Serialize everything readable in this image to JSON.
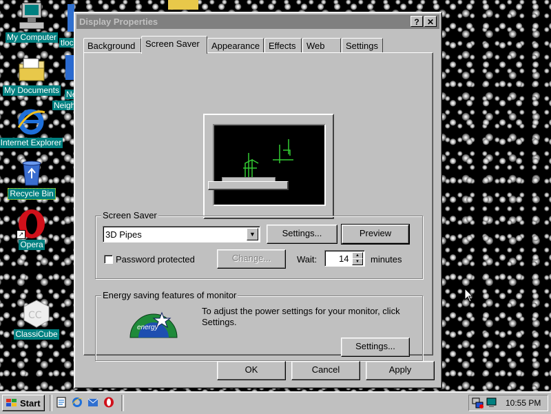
{
  "desktop": {
    "icons": [
      {
        "label": "My Computer"
      },
      {
        "label": "My Documents"
      },
      {
        "label": "Internet Explorer"
      },
      {
        "label": "Recycle Bin"
      },
      {
        "label": "Opera"
      },
      {
        "label": "ClassiCube"
      }
    ],
    "partial_labels": {
      "tloc": "tloc",
      "ne": "Ne",
      "neigh": "Neigh"
    },
    "cursor_icon": "mouse-pointer-icon"
  },
  "window": {
    "title": "Display Properties",
    "help_label": "?",
    "close_label": "✕",
    "tabs": [
      {
        "label": "Background"
      },
      {
        "label": "Screen Saver",
        "active": true
      },
      {
        "label": "Appearance"
      },
      {
        "label": "Effects"
      },
      {
        "label": "Web"
      },
      {
        "label": "Settings"
      }
    ],
    "screen_saver": {
      "group_label": "Screen Saver",
      "selected": "3D Pipes",
      "settings_button": "Settings...",
      "preview_button": "Preview",
      "password_label": "Password protected",
      "password_checked": false,
      "change_button": "Change...",
      "wait_label": "Wait:",
      "wait_value": "14",
      "minutes_label": "minutes"
    },
    "energy": {
      "group_label": "Energy saving features of monitor",
      "description": "To adjust the power settings for your monitor, click Settings.",
      "settings_button": "Settings...",
      "logo_text": "energy"
    },
    "buttons": {
      "ok": "OK",
      "cancel": "Cancel",
      "apply": "Apply"
    },
    "colors": {
      "pipe_green": "#33cc33",
      "screen": "#000000",
      "dialog": "#c0c0c0",
      "desktop_label_bg": "#008080"
    }
  },
  "taskbar": {
    "start_label": "Start",
    "clock": "10:55 PM"
  }
}
